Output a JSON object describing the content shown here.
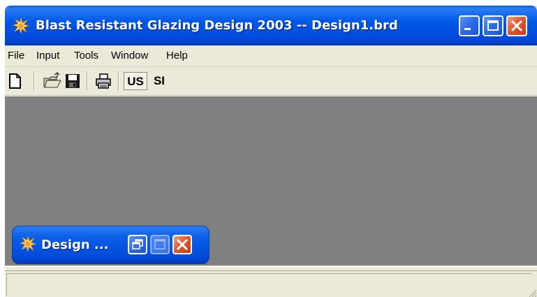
{
  "window": {
    "title": "Blast Resistant Glazing Design 2003 -- Design1.brd",
    "app_icon": "star-burst-icon",
    "controls": [
      "minimize-icon",
      "maximize-icon",
      "close-icon"
    ]
  },
  "menu": {
    "items": [
      {
        "label": "File"
      },
      {
        "label": "Input"
      },
      {
        "label": "Tools"
      },
      {
        "label": "Window"
      },
      {
        "label": "Help"
      }
    ]
  },
  "toolbar": {
    "icons": [
      "new-document-icon",
      "open-folder-icon",
      "save-disk-icon",
      "print-icon"
    ],
    "units": {
      "us_label": "US",
      "si_label": "SI",
      "selected": "US"
    }
  },
  "mdi_child": {
    "title": "Design ...",
    "state": "minimized",
    "controls": [
      "restore-icon",
      "maximize-icon",
      "close-icon"
    ]
  },
  "status": {
    "text": ""
  },
  "colors": {
    "title_bar": "#0058e6",
    "close_button": "#e05a30",
    "chrome": "#ece9d8",
    "mdi_background": "#808080"
  }
}
